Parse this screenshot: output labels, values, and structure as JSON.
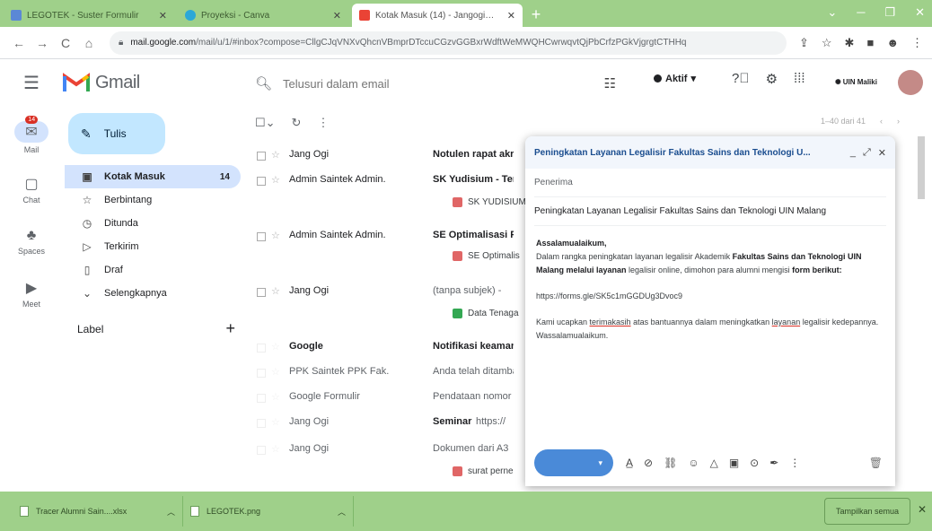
{
  "browser": {
    "tabs": [
      {
        "title": "LEGOTEK - Suster Formulir",
        "color": "#5b88d6"
      },
      {
        "title": "Proyeksi - Canva",
        "color": "#2ba8d8"
      },
      {
        "title": "Kotak Masuk (14) - Jangogi@@",
        "color": "#ea4335"
      }
    ],
    "new_tab": "+",
    "url_host": "mail.google.com",
    "url_path": "/mail/u/1/#inbox?compose=CllgCJqVNXvQhcnVBmprDTccuCGzvGGBxrWdftWeMWQHCwrwqvtQjPbCrfzPGkVjgrgtCTHHq"
  },
  "gmail": {
    "logo_text": "Gmail",
    "search_placeholder": "Telusuri dalam email",
    "status_label": "Aktif",
    "status_caret": "▾",
    "org_logo_text": "UIN Maliki"
  },
  "rail": [
    {
      "label": "Mail",
      "badge": "14"
    },
    {
      "label": "Chat"
    },
    {
      "label": "Spaces"
    },
    {
      "label": "Meet"
    }
  ],
  "sidebar": {
    "compose_label": "Tulis",
    "items": [
      {
        "label": "Kotak Masuk",
        "count": "14"
      },
      {
        "label": "Berbintang"
      },
      {
        "label": "Ditunda"
      },
      {
        "label": "Terkirim"
      },
      {
        "label": "Draf"
      },
      {
        "label": "Selengkapnya"
      }
    ],
    "label_header": "Label",
    "label_plus": "+"
  },
  "list": {
    "pager": "1–40 dari 41",
    "rows": [
      {
        "sender": "Jang Ogi",
        "subject": "Notulen rapat akr",
        "snippet": ""
      },
      {
        "sender": "Admin Saintek Admin.",
        "subject": "SK Yudisium - Ter",
        "snippet": "",
        "chip": "SK YUDISIUM"
      },
      {
        "sender": "Admin Saintek Admin.",
        "subject": "SE Optimalisasi P",
        "snippet": "",
        "chip": "SE Optimalis"
      },
      {
        "sender": "Jang Ogi",
        "subject": "(tanpa subjek) -",
        "snippet": "",
        "chip": "Data Tenaga"
      },
      {
        "sender": "Google",
        "subject": "Notifikasi keaman",
        "snippet": ""
      },
      {
        "sender": "PPK Saintek PPK Fak.",
        "subject": "Anda telah ditamba",
        "snippet": ""
      },
      {
        "sender": "Google Formulir",
        "subject": "Pendataan nomor",
        "snippet": ""
      },
      {
        "sender": "Jang Ogi",
        "subject": "Seminar",
        "snippet": "https://"
      },
      {
        "sender": "Jang Ogi",
        "subject": "Dokumen dari A3",
        "snippet": "",
        "chip": "surat perne"
      }
    ]
  },
  "compose": {
    "title": "Peningkatan Layanan Legalisir Fakultas Sains dan Teknologi U...",
    "to_label": "Penerima",
    "subject": "Peningkatan Layanan Legalisir Fakultas Sains dan Teknologi UIN Malang",
    "body": {
      "greeting": "Assalamualaikum,",
      "p1_a": "Dalam rangka peningkatan layanan legalisir Akademik ",
      "p1_b": "Fakultas Sains dan Teknologi UIN Malang",
      "p1_c": " melalui layanan",
      "p1_d": " legalisir online, dimohon para alumni mengisi ",
      "p1_e": "form berikut:",
      "link": "https://forms.gle/SK5c1mGGDUg3Dvoc9",
      "p2_a": "Kami ucapkan ",
      "p2_b": "terimakasih",
      "p2_c": " atas bantuannya dalam meningkatkan ",
      "p2_d": "layanan",
      "p2_e": " legalisir kedepannya.",
      "closing": "Wassalamualaikum."
    },
    "send_caret": "▾"
  },
  "downloads": {
    "items": [
      {
        "name": "Tracer Alumni Sain....xlsx"
      },
      {
        "name": "LEGOTEK.png"
      }
    ],
    "show_all": "Tampilkan semua",
    "close": "✕"
  }
}
